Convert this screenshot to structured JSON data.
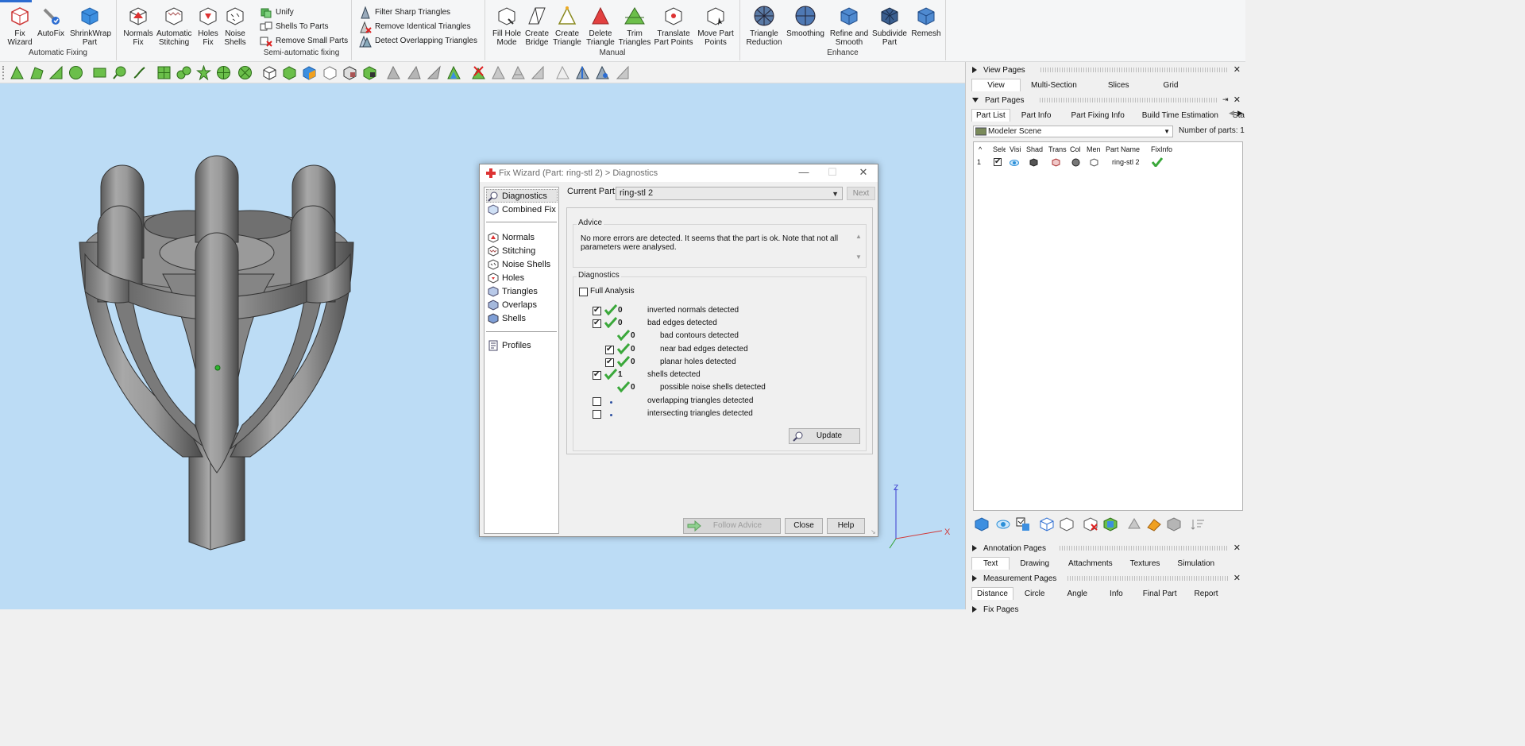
{
  "ribbon": {
    "groups": [
      {
        "label": "Automatic Fixing",
        "buttons": [
          "Fix Wizard",
          "AutoFix",
          "ShrinkWrap Part"
        ]
      },
      {
        "label": "Semi-automatic fixing",
        "buttons": [
          "Normals Fix",
          "Automatic Stitching",
          "Holes Fix",
          "Noise Shells"
        ],
        "small_buttons": [
          "Unify",
          "Shells To Parts",
          "Remove Small Parts"
        ]
      },
      {
        "label": "",
        "small_buttons": [
          "Filter Sharp Triangles",
          "Remove Identical Triangles",
          "Detect Overlapping Triangles"
        ]
      },
      {
        "label": "Manual",
        "buttons": [
          "Fill Hole Mode",
          "Create Bridge",
          "Create Triangle",
          "Delete Triangle",
          "Trim Triangles",
          "Translate Part Points",
          "Move Part Points"
        ]
      },
      {
        "label": "Enhance",
        "buttons": [
          "Triangle Reduction",
          "Smoothing",
          "Refine and Smooth",
          "Subdivide Part",
          "Remesh"
        ]
      }
    ],
    "labels": {
      "fix_wizard": "Fix\nWizard",
      "autofix": "AutoFix",
      "shrinkwrap": "ShrinkWrap\nPart",
      "normals_fix": "Normals\nFix",
      "auto_stitching": "Automatic\nStitching",
      "holes_fix": "Holes\nFix",
      "noise_shells": "Noise\nShells",
      "unify": "Unify",
      "shells_to_parts": "Shells To Parts",
      "remove_small_parts": "Remove Small Parts",
      "filter_sharp": "Filter Sharp Triangles",
      "remove_identical": "Remove Identical Triangles",
      "detect_overlapping": "Detect Overlapping Triangles",
      "fill_hole": "Fill Hole\nMode",
      "create_bridge": "Create\nBridge",
      "create_triangle": "Create\nTriangle",
      "delete_triangle": "Delete\nTriangle",
      "trim_triangles": "Trim\nTriangles",
      "translate_points": "Translate\nPart Points",
      "move_points": "Move Part\nPoints",
      "triangle_reduction": "Triangle\nReduction",
      "smoothing": "Smoothing",
      "refine_smooth": "Refine and\nSmooth",
      "subdivide": "Subdivide\nPart",
      "remesh": "Remesh",
      "group_auto": "Automatic Fixing",
      "group_semi": "Semi-automatic fixing",
      "group_manual": "Manual",
      "group_enhance": "Enhance"
    }
  },
  "dialog": {
    "title": "Fix Wizard (Part: ring-stl 2) > Diagnostics",
    "nav": {
      "diagnostics": "Diagnostics",
      "combined_fix": "Combined Fix",
      "normals": "Normals",
      "stitching": "Stitching",
      "noise_shells": "Noise Shells",
      "holes": "Holes",
      "triangles": "Triangles",
      "overlaps": "Overlaps",
      "shells": "Shells",
      "profiles": "Profiles"
    },
    "current_part_label": "Current Part:",
    "current_part_value": "ring-stl 2",
    "next_label": "Next",
    "advice_title": "Advice",
    "advice_text": "No more errors are detected. It seems that the part is ok. Note that not all parameters were analysed.",
    "diagnostics_title": "Diagnostics",
    "full_analysis_label": "Full Analysis",
    "rows": [
      {
        "count": "0",
        "label": "inverted normals detected",
        "checked": true,
        "ok": true
      },
      {
        "count": "0",
        "label": "bad edges detected",
        "checked": true,
        "ok": true
      },
      {
        "count": "0",
        "label": "bad contours detected",
        "checked": null,
        "ok": true
      },
      {
        "count": "0",
        "label": "near bad edges detected",
        "checked": true,
        "ok": true
      },
      {
        "count": "0",
        "label": "planar holes detected",
        "checked": true,
        "ok": true
      },
      {
        "count": "1",
        "label": "shells detected",
        "checked": true,
        "ok": true
      },
      {
        "count": "0",
        "label": "possible noise shells detected",
        "checked": null,
        "ok": true
      },
      {
        "count": "",
        "label": "overlapping triangles detected",
        "checked": false,
        "ok": false
      },
      {
        "count": "",
        "label": "intersecting triangles detected",
        "checked": false,
        "ok": false
      }
    ],
    "update_label": "Update",
    "follow_advice_label": "Follow Advice",
    "close_label": "Close",
    "help_label": "Help"
  },
  "right_panel": {
    "view_pages": {
      "title": "View Pages",
      "tabs": [
        "View",
        "Multi-Section",
        "Slices",
        "Grid"
      ]
    },
    "part_pages": {
      "title": "Part Pages",
      "tabs": [
        "Part List",
        "Part Info",
        "Part Fixing Info",
        "Build Time Estimation",
        "Sta"
      ]
    },
    "scene": "Modeler Scene",
    "number_of_parts_label": "Number of parts: 1",
    "columns": [
      "Sele",
      "Visi",
      "Shad",
      "Trans",
      "Col",
      "Men",
      "Part Name",
      "FixInfo"
    ],
    "row": {
      "index": "1",
      "part_name": "ring-stl 2"
    },
    "annotation_pages": {
      "title": "Annotation Pages",
      "tabs": [
        "Text",
        "Drawing",
        "Attachments",
        "Textures",
        "Simulation"
      ]
    },
    "measurement_pages": {
      "title": "Measurement Pages",
      "tabs": [
        "Distance",
        "Circle",
        "Angle",
        "Info",
        "Final Part",
        "Report"
      ]
    },
    "fix_pages": {
      "title": "Fix Pages"
    }
  },
  "axes": {
    "z": "Z",
    "x": "X"
  },
  "colors": {
    "viewport_bg": "#bcdcf5",
    "accent": "#2b6cd1",
    "ok_green": "#3aa83a"
  }
}
